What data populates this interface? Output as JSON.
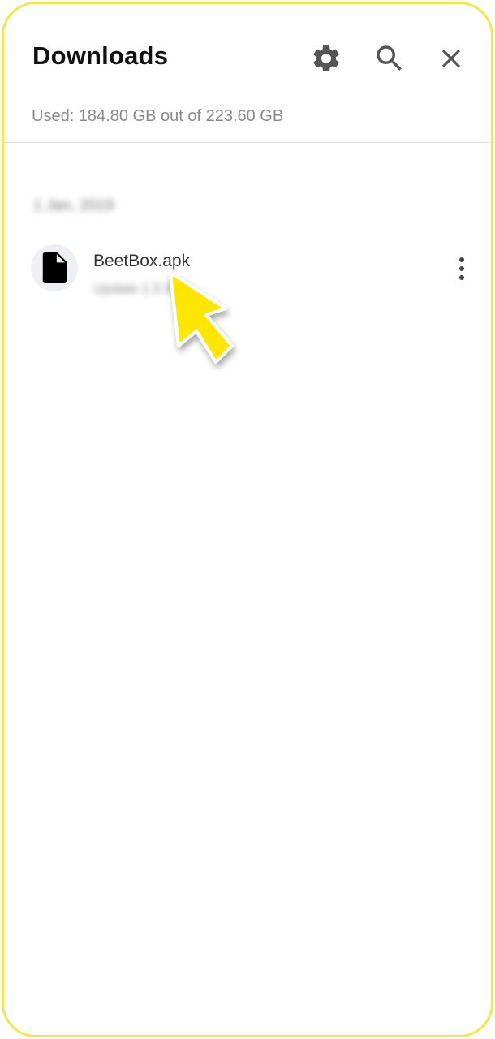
{
  "header": {
    "title": "Downloads",
    "icons": {
      "settings": "gear-icon",
      "search": "search-icon",
      "close": "close-icon"
    }
  },
  "storage": {
    "text": "Used: 184.80 GB out of 223.60 GB"
  },
  "list": {
    "date_header": "1 Jan, 2019",
    "items": [
      {
        "name": "BeetBox.apk",
        "meta": "Update 1.5 MB",
        "icon": "file-icon"
      }
    ]
  },
  "colors": {
    "frame": "#f6e64a",
    "pointer": "#ffe600",
    "title": "#111111",
    "secondary_text": "#8a8a8a",
    "icon": "#555555"
  }
}
